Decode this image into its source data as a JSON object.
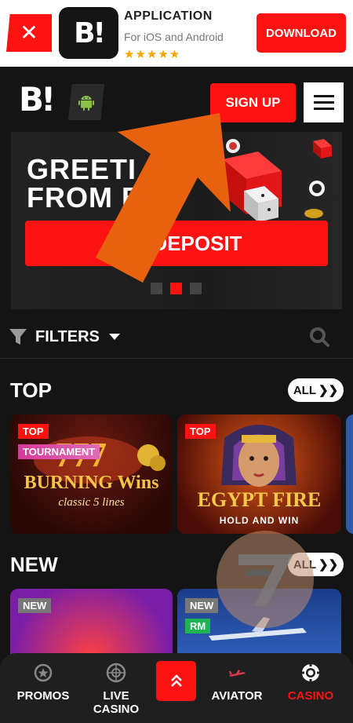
{
  "promo_bar": {
    "title": "APPLICATION",
    "subtitle": "For iOS and Android",
    "stars": "★★★★★",
    "download_label": "DOWNLOAD",
    "app_logo_text": "B!"
  },
  "header": {
    "brand": "B!",
    "signup_label": "SIGN UP"
  },
  "hero": {
    "title_line1": "GREETI",
    "title_line2": "FROM B",
    "deposit_label": "M A DEPOSIT"
  },
  "filters": {
    "label": "FILTERS"
  },
  "sections": {
    "top": {
      "title": "TOP",
      "all_label": "ALL",
      "cards": [
        {
          "tags": [
            "TOP",
            "TOURNAMENT"
          ],
          "name": "BURNING Wins",
          "subname": "classic 5 lines"
        },
        {
          "tags": [
            "TOP"
          ],
          "name": "EGYPT FIRE",
          "subname": "HOLD AND WIN"
        }
      ]
    },
    "new": {
      "title": "NEW",
      "all_label": "ALL",
      "cards": [
        {
          "tags": [
            "NEW"
          ]
        },
        {
          "tags": [
            "NEW",
            "RM"
          ]
        }
      ]
    }
  },
  "bottom_nav": {
    "items": [
      {
        "label": "PROMOS",
        "icon": "promo-star-icon"
      },
      {
        "label": "LIVE\nCASINO",
        "icon": "roulette-icon"
      },
      {
        "label": "",
        "icon": "chevron-up-icon"
      },
      {
        "label": "AVIATOR",
        "icon": "plane-icon"
      },
      {
        "label": "CASINO",
        "icon": "chip-icon"
      }
    ]
  },
  "colors": {
    "accent": "#ff1212",
    "background": "#141414",
    "arrow": "#e8610f"
  }
}
